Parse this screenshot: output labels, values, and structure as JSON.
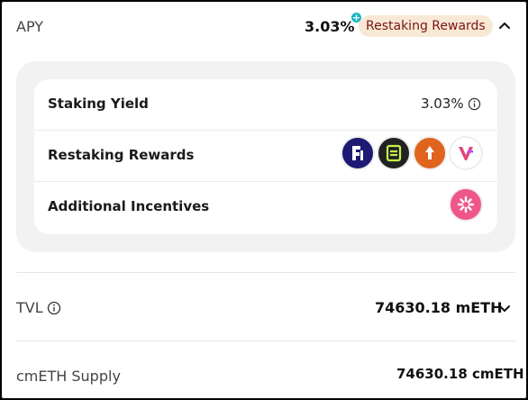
{
  "apy": {
    "label": "APY",
    "value": "3.03%",
    "plus_badge": "+",
    "restaking_pill": "Restaking Rewards",
    "expand_icon": "chevron-up-icon"
  },
  "breakdown": {
    "staking_yield": {
      "label": "Staking Yield",
      "value": "3.03%",
      "icon": "info-icon"
    },
    "restaking_rewards": {
      "label": "Restaking Rewards",
      "tokens": [
        "eigenlayer-logo-icon",
        "symbiotic-logo-icon",
        "karak-logo-icon",
        "veda-logo-icon"
      ]
    },
    "additional_incentives": {
      "label": "Additional Incentives",
      "tokens": [
        "cook-logo-icon"
      ]
    }
  },
  "tvl": {
    "label": "TVL",
    "value": "74630.18 mETH",
    "icon": "info-icon",
    "expand_icon": "chevron-down-icon"
  },
  "cmeth_supply": {
    "label": "cmETH Supply",
    "value": "74630.18 cmETH"
  },
  "colors": {
    "pill_bg": "#f8e9d6",
    "pill_text": "#7a1515",
    "plus_badge": "#19b4c8",
    "card_bg": "#f2f2f2"
  }
}
